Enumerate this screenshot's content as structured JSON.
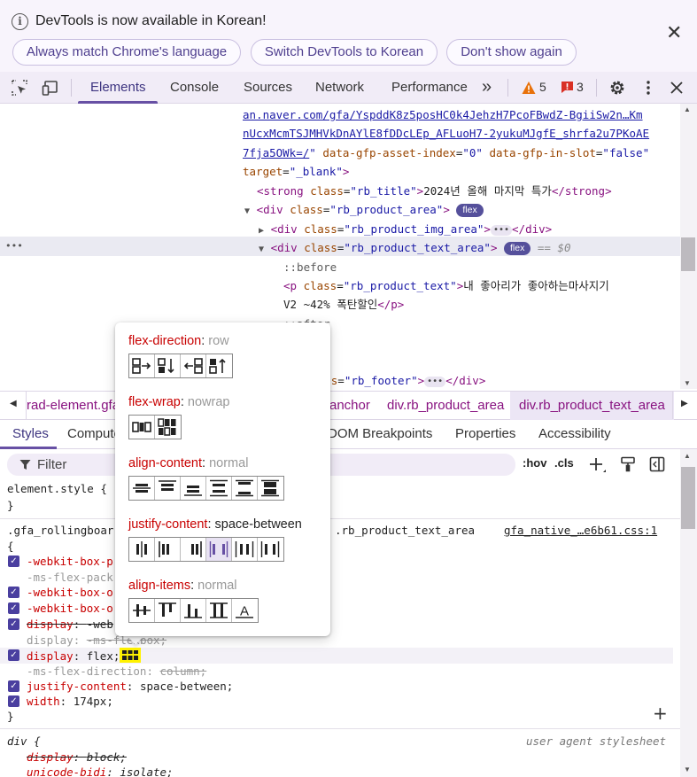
{
  "infobar": {
    "message": "DevTools is now available in Korean!",
    "buttons": [
      "Always match Chrome's language",
      "Switch DevTools to Korean",
      "Don't show again"
    ],
    "close_glyph": "✕"
  },
  "toolbar": {
    "tabs": [
      "Elements",
      "Console",
      "Sources",
      "Network",
      "Performance"
    ],
    "active_tab": "Elements",
    "more_glyph": "»",
    "warnings_count": "5",
    "errors_count": "3"
  },
  "dom": {
    "url_line1": "an.naver.com/gfa/YspddK8z5posHC0k4JehzH7PcoFBwdZ-BgiiSw2n…Km",
    "url_line2": "nUcxMcmTSJMHVkDnAYlE8fDDcLEp_AFLuoH7-2yukuMJgfE_shrfa2u7PKoAE",
    "url_line3_link": "7fja5OWk=/",
    "url_line3_rest_attr1": " data-gfp-asset-index",
    "url_line3_val1": "\"0\"",
    "url_line3_rest_attr2": " data-gfp-in-slot",
    "url_line3_val2": "\"false\"",
    "target_attr": "target",
    "target_val": "\"_blank\"",
    "strong_class": "\"rb_title\"",
    "strong_text": "2024년 올해 마지막 특가",
    "div_area_class": "\"rb_product_area\"",
    "img_area_class": "\"rb_product_img_area\"",
    "text_area_class": "\"rb_product_text_area\"",
    "selected_marker": "== $0",
    "before": "::before",
    "p_class": "\"rb_product_text\"",
    "p_text1": "내 좋아리가 좋아하는마사지기",
    "p_text2": "V2 ~42% 폭탄할인",
    "after": "::after",
    "footer_class": "\"rb_footer\"",
    "flex_badge": "flex",
    "row_dots": "•••"
  },
  "breadcrumbs": [
    "rad-element.gfa",
    "anchor",
    "div.rb_product_area",
    "div.rb_product_text_area"
  ],
  "subtabs": [
    "Styles",
    "Computed",
    "DOM Breakpoints",
    "Properties",
    "Accessibility"
  ],
  "filter": {
    "placeholder": "Filter",
    "hov": ":hov",
    "cls": ".cls"
  },
  "styles": {
    "element_style": "element.style {",
    "close_brace": "}",
    "open_brace": "{",
    "rule_selector_left": ".gfa_rollingboar",
    "rule_selector_right": ".rb_product_text_area",
    "rule_source": "gfa_native_…e6b61.css:1",
    "props": [
      {
        "name": "-webkit-box-p",
        "value": ""
      },
      {
        "name": "-ms-flex-pack",
        "value": ""
      },
      {
        "name": "-webkit-box-o",
        "value": ""
      },
      {
        "name": "-webkit-box-o",
        "value": ""
      },
      {
        "name": "display",
        "value": "-web"
      },
      {
        "name": "display",
        "value": "-ms-flexbox;"
      },
      {
        "name": "display",
        "value": "flex;"
      },
      {
        "name": "-ms-flex-direction",
        "value": "column;"
      },
      {
        "name": "justify-content",
        "value": "space-between;"
      },
      {
        "name": "width",
        "value": "174px;"
      }
    ],
    "ua_selector": "div {",
    "ua_label": "user agent stylesheet",
    "ua_props": [
      {
        "name": "display",
        "value": "block;"
      },
      {
        "name": "unicode-bidi",
        "value": "isolate;"
      }
    ],
    "add_glyph": "+"
  },
  "flex_editor": {
    "sections": [
      {
        "prop": "flex-direction",
        "value": "row",
        "set": false
      },
      {
        "prop": "flex-wrap",
        "value": "nowrap",
        "set": false
      },
      {
        "prop": "align-content",
        "value": "normal",
        "set": false
      },
      {
        "prop": "justify-content",
        "value": "space-between",
        "set": true
      },
      {
        "prop": "align-items",
        "value": "normal",
        "set": false
      }
    ],
    "align_items_text_glyph": "A"
  },
  "colors": {
    "accent": "#6750a4",
    "tag": "#881280",
    "attr": "#994500",
    "value": "#1a1aa6",
    "property": "#c80000",
    "warning": "#e8710a",
    "error": "#d93025"
  }
}
